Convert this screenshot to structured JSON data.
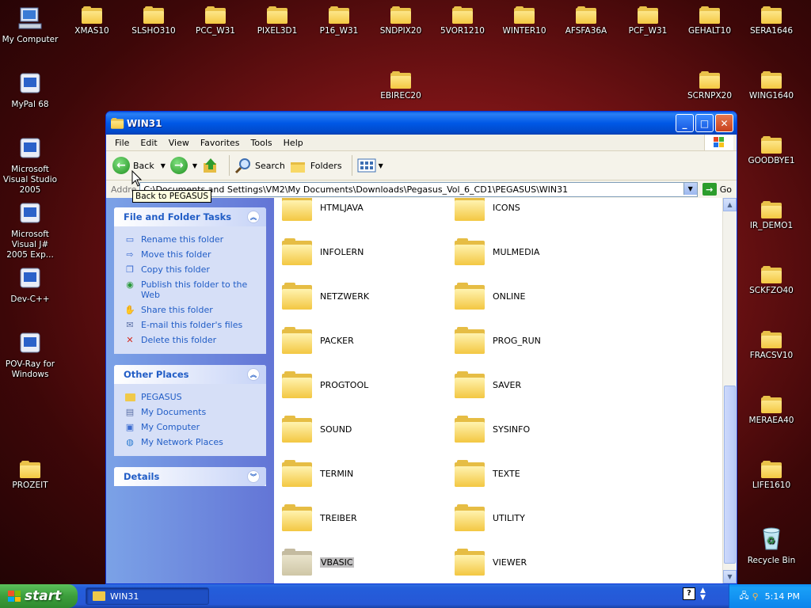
{
  "desktop": {
    "icons": [
      {
        "label": "My Computer",
        "type": "computer"
      },
      {
        "label": "XMAS10",
        "type": "folder"
      },
      {
        "label": "SLSHO310",
        "type": "folder"
      },
      {
        "label": "PCC_W31",
        "type": "folder"
      },
      {
        "label": "PIXEL3D1",
        "type": "folder"
      },
      {
        "label": "P16_W31",
        "type": "folder"
      },
      {
        "label": "SNDPIX20",
        "type": "folder"
      },
      {
        "label": "5VOR1210",
        "type": "folder"
      },
      {
        "label": "WINTER10",
        "type": "folder"
      },
      {
        "label": "AFSFA36A",
        "type": "folder"
      },
      {
        "label": "PCF_W31",
        "type": "folder"
      },
      {
        "label": "GEHALT10",
        "type": "folder"
      },
      {
        "label": "SERA1646",
        "type": "folder"
      },
      {
        "label": "MyPal 68",
        "type": "app"
      },
      {
        "label": "EBIREC20",
        "type": "folder"
      },
      {
        "label": "SCRNPX20",
        "type": "folder"
      },
      {
        "label": "WING1640",
        "type": "folder"
      },
      {
        "label": "Microsoft Visual Studio 2005",
        "type": "app"
      },
      {
        "label": "GOODBYE1",
        "type": "folder"
      },
      {
        "label": "Microsoft Visual J# 2005 Exp...",
        "type": "app"
      },
      {
        "label": "IR_DEMO1",
        "type": "folder"
      },
      {
        "label": "Dev-C++",
        "type": "app"
      },
      {
        "label": "SCKFZO40",
        "type": "folder"
      },
      {
        "label": "POV-Ray for Windows",
        "type": "app"
      },
      {
        "label": "FRACSV10",
        "type": "folder"
      },
      {
        "label": "MERAEA40",
        "type": "folder"
      },
      {
        "label": "PROZEIT",
        "type": "folder"
      },
      {
        "label": "LIFE1610",
        "type": "folder"
      },
      {
        "label": "Recycle Bin",
        "type": "recycle"
      }
    ]
  },
  "window": {
    "title": "WIN31",
    "menu": [
      "File",
      "Edit",
      "View",
      "Favorites",
      "Tools",
      "Help"
    ],
    "toolbar": {
      "back": "Back",
      "search": "Search",
      "folders": "Folders"
    },
    "tooltip": "Back to PEGASUS",
    "address": {
      "label": "Addre",
      "path": "C:\\Documents and Settings\\VM2\\My Documents\\Downloads\\Pegasus_Vol_6_CD1\\PEGASUS\\WIN31",
      "go": "Go"
    },
    "file_tasks": {
      "title": "File and Folder Tasks",
      "items": [
        {
          "label": "Rename this folder",
          "icon": "rename-icon"
        },
        {
          "label": "Move this folder",
          "icon": "move-icon"
        },
        {
          "label": "Copy this folder",
          "icon": "copy-icon"
        },
        {
          "label": "Publish this folder to the Web",
          "icon": "publish-icon"
        },
        {
          "label": "Share this folder",
          "icon": "share-icon"
        },
        {
          "label": "E-mail this folder's files",
          "icon": "email-icon"
        },
        {
          "label": "Delete this folder",
          "icon": "delete-icon"
        }
      ]
    },
    "other_places": {
      "title": "Other Places",
      "items": [
        {
          "label": "PEGASUS",
          "icon": "folder-icon"
        },
        {
          "label": "My Documents",
          "icon": "documents-icon"
        },
        {
          "label": "My Computer",
          "icon": "computer-icon"
        },
        {
          "label": "My Network Places",
          "icon": "network-icon"
        }
      ]
    },
    "details": {
      "title": "Details"
    },
    "folders": [
      "HTMLJAVA",
      "ICONS",
      "INFOLERN",
      "MULMEDIA",
      "NETZWERK",
      "ONLINE",
      "PACKER",
      "PROG_RUN",
      "PROGTOOL",
      "SAVER",
      "SOUND",
      "SYSINFO",
      "TERMIN",
      "TEXTE",
      "TREIBER",
      "UTILITY",
      "VBASIC",
      "VIEWER"
    ],
    "selected_folder": "VBASIC"
  },
  "taskbar": {
    "start": "start",
    "task": "WIN31",
    "clock": "5:14 PM"
  }
}
